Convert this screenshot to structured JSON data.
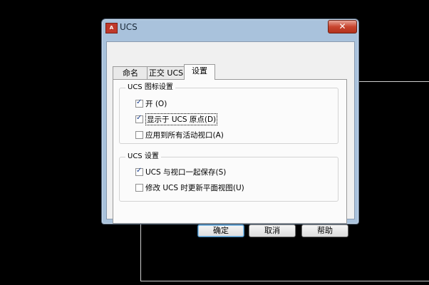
{
  "dialog": {
    "app_icon_text": "A",
    "title": "UCS",
    "close_glyph": "✕"
  },
  "tabs": [
    {
      "label": "命名 UCS"
    },
    {
      "label": "正交 UCS"
    },
    {
      "label": "设置"
    }
  ],
  "ucs_icon_group": {
    "title": "UCS 图标设置",
    "options": [
      {
        "label": "开 (O)",
        "checked": true
      },
      {
        "label": "显示于 UCS 原点(D)",
        "checked": true
      },
      {
        "label": "应用到所有活动视口(A)",
        "checked": false
      }
    ]
  },
  "ucs_settings_group": {
    "title": "UCS 设置",
    "options": [
      {
        "label": "UCS 与视口一起保存(S)",
        "checked": true
      },
      {
        "label": "修改 UCS 时更新平面视图(U)",
        "checked": false
      }
    ]
  },
  "buttons": {
    "ok": "确定",
    "cancel": "取消",
    "help": "帮助"
  }
}
